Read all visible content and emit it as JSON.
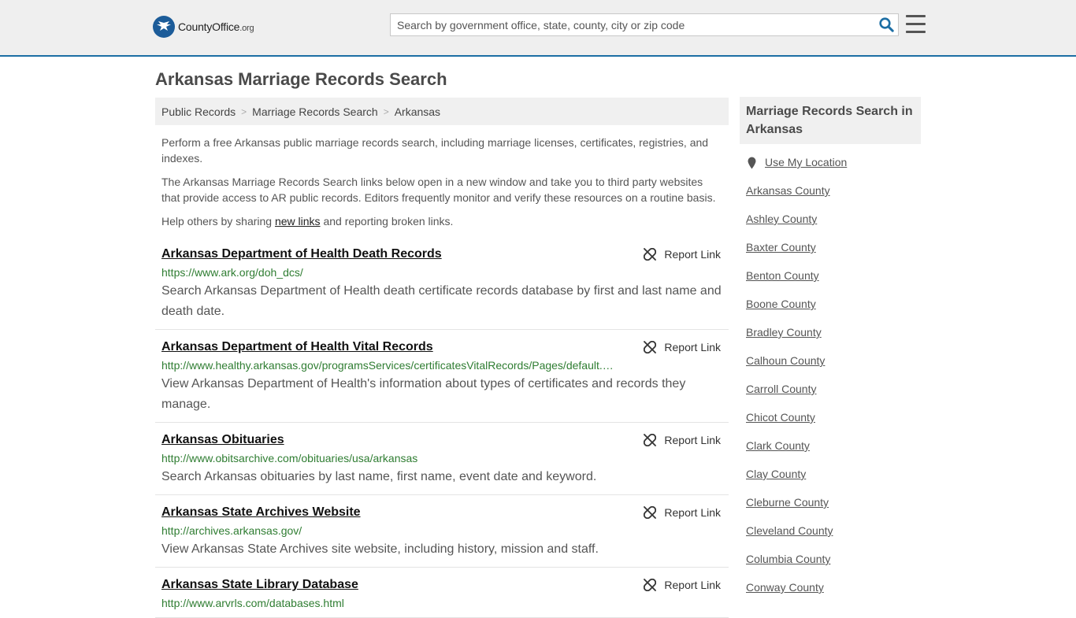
{
  "header": {
    "logo_main": "CountyOffice",
    "logo_ext": ".org",
    "search_placeholder": "Search by government office, state, county, city or zip code"
  },
  "page_title": "Arkansas Marriage Records Search",
  "breadcrumb": [
    "Public Records",
    "Marriage Records Search",
    "Arkansas"
  ],
  "intro": {
    "p1": "Perform a free Arkansas public marriage records search, including marriage licenses, certificates, registries, and indexes.",
    "p2": "The Arkansas Marriage Records Search links below open in a new window and take you to third party websites that provide access to AR public records. Editors frequently monitor and verify these resources on a routine basis.",
    "p3_before": "Help others by sharing ",
    "p3_link": "new links",
    "p3_after": " and reporting broken links."
  },
  "report_label": "Report Link",
  "results": [
    {
      "title": "Arkansas Department of Health Death Records",
      "url": "https://www.ark.org/doh_dcs/",
      "desc": "Search Arkansas Department of Health death certificate records database by first and last name and death date."
    },
    {
      "title": "Arkansas Department of Health Vital Records",
      "url": "http://www.healthy.arkansas.gov/programsServices/certificatesVitalRecords/Pages/default.…",
      "desc": "View Arkansas Department of Health's information about types of certificates and records they manage."
    },
    {
      "title": "Arkansas Obituaries",
      "url": "http://www.obitsarchive.com/obituaries/usa/arkansas",
      "desc": "Search Arkansas obituaries by last name, first name, event date and keyword."
    },
    {
      "title": "Arkansas State Archives Website",
      "url": "http://archives.arkansas.gov/",
      "desc": "View Arkansas State Archives site website, including history, mission and staff."
    },
    {
      "title": "Arkansas State Library Database",
      "url": "http://www.arvrls.com/databases.html",
      "desc": ""
    }
  ],
  "sidebar": {
    "title": "Marriage Records Search in Arkansas",
    "use_location": "Use My Location",
    "counties": [
      "Arkansas County",
      "Ashley County",
      "Baxter County",
      "Benton County",
      "Boone County",
      "Bradley County",
      "Calhoun County",
      "Carroll County",
      "Chicot County",
      "Clark County",
      "Clay County",
      "Cleburne County",
      "Cleveland County",
      "Columbia County",
      "Conway County"
    ]
  },
  "colors": {
    "brand_blue": "#1c5c99",
    "url_green": "#2f7d32",
    "search_icon": "#1c6ea4"
  }
}
